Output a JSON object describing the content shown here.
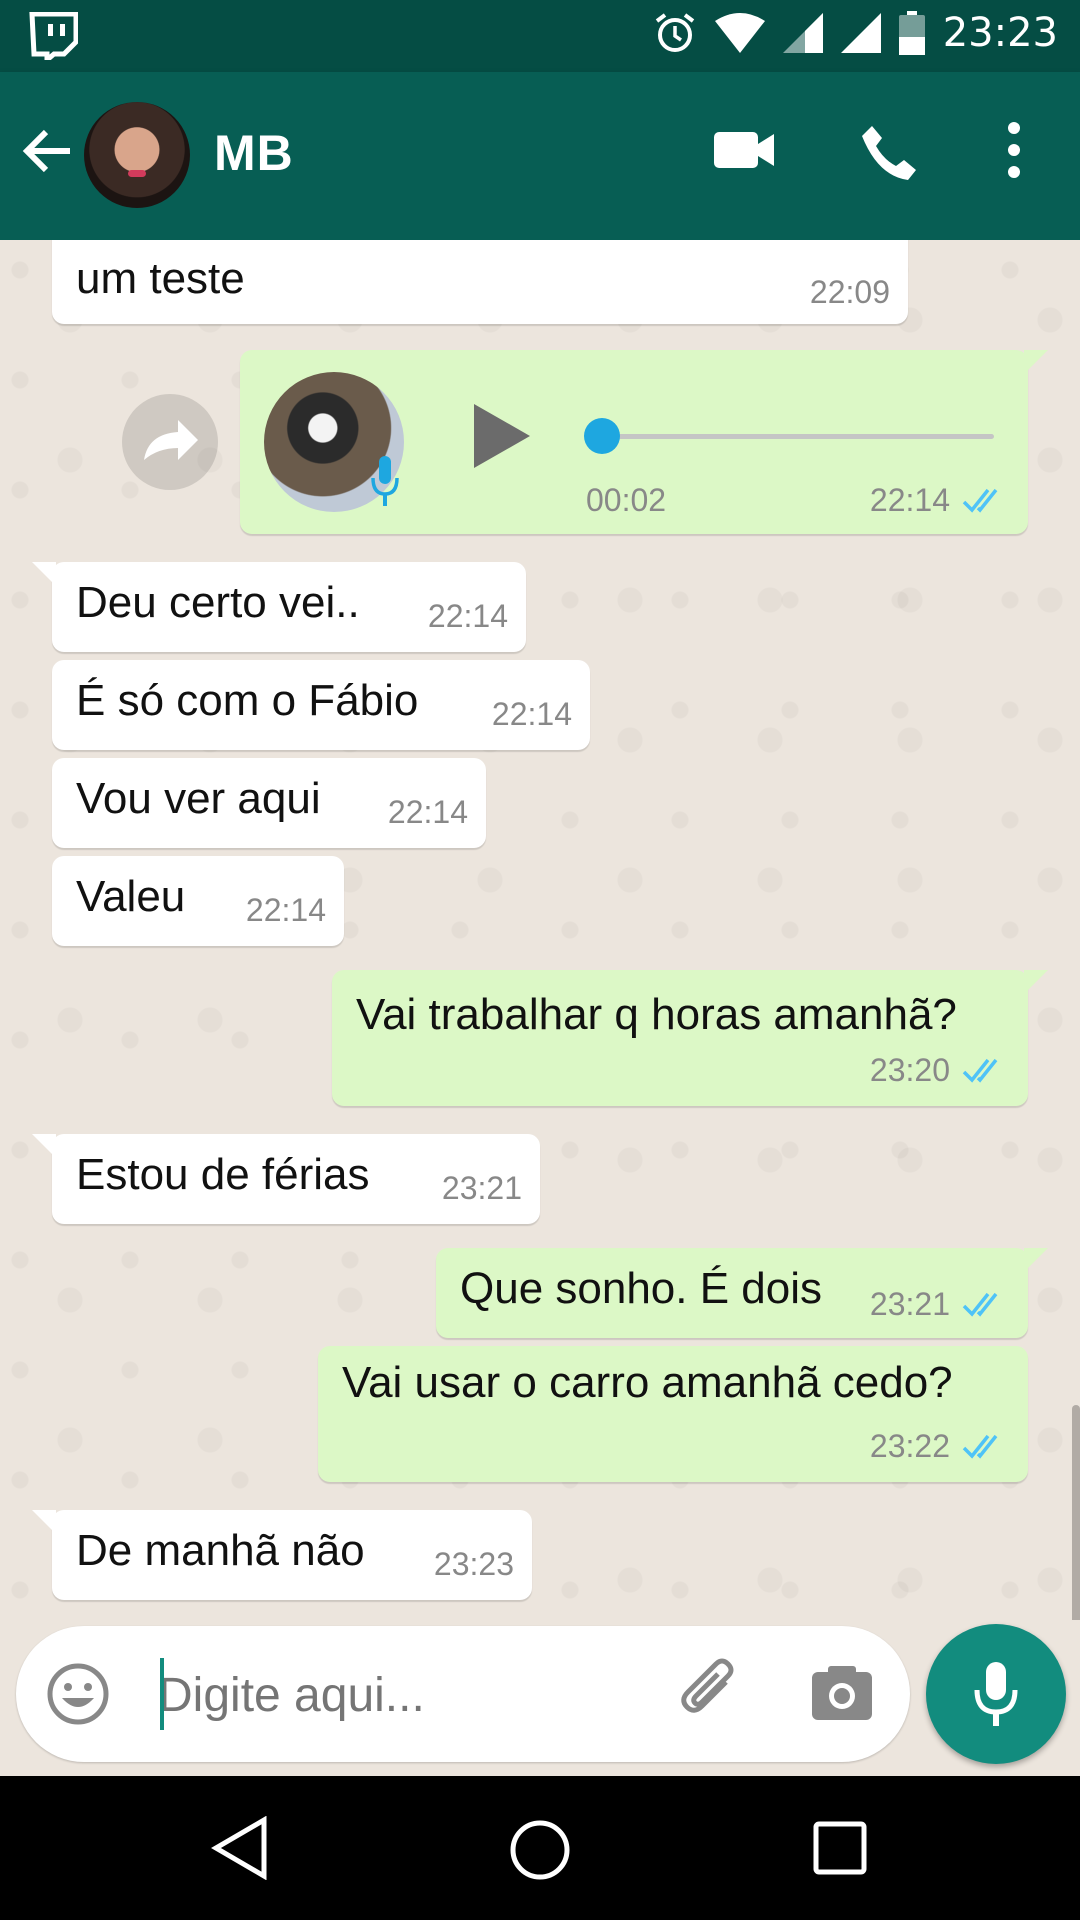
{
  "status_bar": {
    "time": "23:23"
  },
  "header": {
    "contact_name": "MB"
  },
  "messages": [
    {
      "dir": "in",
      "text": "um teste",
      "time": "22:09"
    },
    {
      "dir": "out",
      "type": "voice",
      "duration": "00:02",
      "time": "22:14",
      "progress": 0
    },
    {
      "dir": "in",
      "text": "Deu certo vei..",
      "time": "22:14"
    },
    {
      "dir": "in",
      "text": "É só com o Fábio",
      "time": "22:14"
    },
    {
      "dir": "in",
      "text": "Vou ver aqui",
      "time": "22:14"
    },
    {
      "dir": "in",
      "text": "Valeu",
      "time": "22:14"
    },
    {
      "dir": "out",
      "text": "Vai trabalhar q horas amanhã?",
      "time": "23:20"
    },
    {
      "dir": "in",
      "text": "Estou de férias",
      "time": "23:21"
    },
    {
      "dir": "out",
      "text": "Que sonho. É dois",
      "time": "23:21"
    },
    {
      "dir": "out",
      "text": "Vai usar o carro amanhã cedo?",
      "time": "23:22"
    },
    {
      "dir": "in",
      "text": "De manhã não",
      "time": "23:23"
    }
  ],
  "composer": {
    "placeholder": "Digite aqui..."
  },
  "colors": {
    "header": "#075e54",
    "status_bar": "#054d44",
    "outgoing": "#dcf8c6",
    "incoming": "#ffffff",
    "accent": "#128c7e",
    "read_ticks": "#4fc3f7"
  },
  "icons": [
    "twitch-icon",
    "alarm-icon",
    "wifi-icon",
    "signal-icon",
    "battery-icon",
    "back-arrow-icon",
    "video-call-icon",
    "phone-icon",
    "more-vert-icon",
    "forward-icon",
    "play-icon",
    "mic-icon",
    "emoji-icon",
    "attach-icon",
    "camera-icon",
    "nav-back-icon",
    "nav-home-icon",
    "nav-recents-icon"
  ]
}
